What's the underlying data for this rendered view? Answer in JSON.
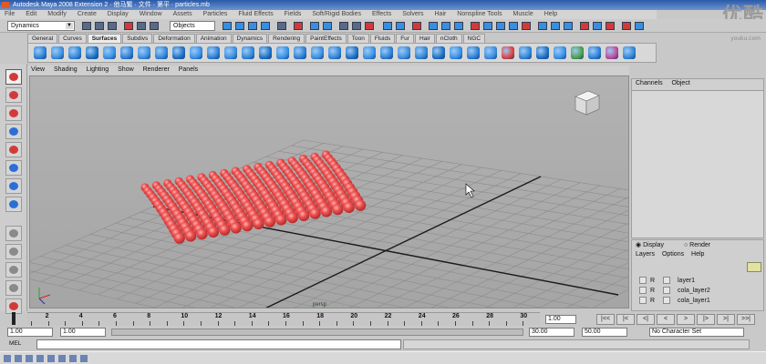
{
  "window": {
    "title": "Autodesk Maya 2008 Extension 2 · 他马繁 · 文件 · 第平 · particles.mb"
  },
  "watermark": {
    "text": "优酷",
    "subtext": "youku.com"
  },
  "menubar": {
    "items": [
      "File",
      "Edit",
      "Modify",
      "Create",
      "Display",
      "Window",
      "Assets",
      "Particles",
      "Fluid Effects",
      "Fields",
      "Soft/Rigid Bodies",
      "Effects",
      "Solvers",
      "Hair",
      "Nonspline Tools",
      "Muscle",
      "Help"
    ]
  },
  "statusline": {
    "mode": "Dynamics",
    "objects_field": "Objects"
  },
  "shelf": {
    "tabs": [
      "General",
      "Curves",
      "Surfaces",
      "Subdivs",
      "Deformation",
      "Animation",
      "Dynamics",
      "Rendering",
      "PaintEffects",
      "Toon",
      "Fluids",
      "Fur",
      "Hair",
      "nCloth",
      "NGC"
    ],
    "active_tab": "Surfaces",
    "icon_colors": [
      "#2b7fd6",
      "#3a8ee0",
      "#2f86d8",
      "#1d6fc2",
      "#3690e6",
      "#2b7fd6",
      "#3a8ee0",
      "#2f86d8",
      "#1d6fc2",
      "#3690e6",
      "#2b7fd6",
      "#3a8ee0",
      "#2f86d8",
      "#1d6fc2",
      "#3690e6",
      "#2b7fd6",
      "#3a8ee0",
      "#2f86d8",
      "#1d6fc2",
      "#3690e6",
      "#2b7fd6",
      "#3a8ee0",
      "#2f86d8",
      "#1d6fc2",
      "#3690e6",
      "#2b7fd6",
      "#3a8ee0",
      "#e04040",
      "#2f86d8",
      "#1d6fc2",
      "#3690e6",
      "#4aa048",
      "#2b7fd6",
      "#c04a9a",
      "#2f86d8"
    ]
  },
  "tools": {
    "icons": [
      "select-tool-icon",
      "lasso-tool-icon",
      "paint-select-tool-icon",
      "move-tool-icon",
      "rotate-tool-icon",
      "scale-tool-icon",
      "manipulator-tool-icon",
      "last-tool-icon",
      "layout-single-icon",
      "layout-four-icon",
      "layout-two-icon",
      "layout-outliner-icon",
      "render-view-icon"
    ],
    "colors": [
      "#d23a3a",
      "#d23a3a",
      "#d23a3a",
      "#2b6fd6",
      "#d23a3a",
      "#2b6fd6",
      "#2b6fd6",
      "#2b6fd6",
      "#8a8a8a",
      "#8a8a8a",
      "#8a8a8a",
      "#8a8a8a",
      "#d23a3a"
    ]
  },
  "panel": {
    "menu": [
      "View",
      "Shading",
      "Lighting",
      "Show",
      "Renderer",
      "Panels"
    ],
    "camera_label": "persp",
    "particle_color": "#ec5050"
  },
  "channel_box": {
    "menu": [
      "Channels",
      "Object"
    ]
  },
  "layers": {
    "radio_display": "Display",
    "radio_render": "Render",
    "menu": [
      "Layers",
      "Options",
      "Help"
    ],
    "rows": [
      {
        "flag": "R",
        "name": "layer1"
      },
      {
        "flag": "R",
        "name": "cola_layer2"
      },
      {
        "flag": "R",
        "name": "cola_layer1"
      }
    ]
  },
  "timeline": {
    "ticks": [
      "2",
      "4",
      "6",
      "8",
      "10",
      "12",
      "14",
      "16",
      "18",
      "20",
      "22",
      "24",
      "26",
      "28",
      "30"
    ],
    "current_time": "1.00",
    "playback_buttons": [
      "|<<",
      "|<",
      "<|",
      "<",
      ">",
      "|>",
      ">|",
      ">>|"
    ]
  },
  "range": {
    "start": "1.00",
    "start_inner": "1.00",
    "end_inner": "30.00",
    "end": "50.00",
    "character_set": "No Character Set"
  },
  "command_line": {
    "label": "MEL"
  }
}
